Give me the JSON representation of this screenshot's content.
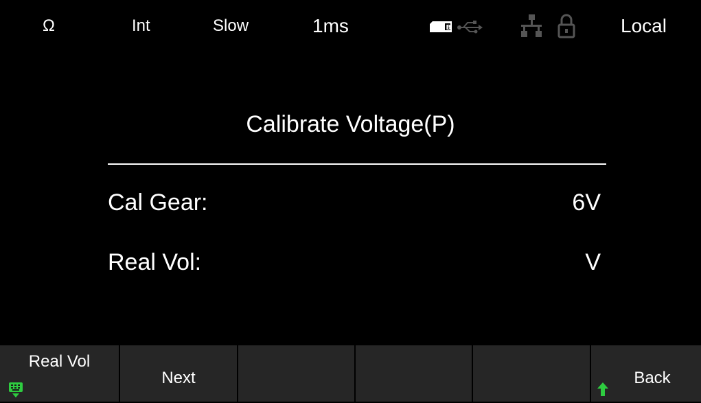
{
  "status": {
    "mode_symbol": "Ω",
    "trigger": "Int",
    "speed": "Slow",
    "time": "1ms",
    "remote_state": "Local",
    "icons": [
      "memory-card-icon",
      "usb-icon",
      "network-icon",
      "lock-icon"
    ]
  },
  "main": {
    "title": "Calibrate Voltage(P)",
    "rows": [
      {
        "label": "Cal Gear:",
        "value": "6V"
      },
      {
        "label": "Real Vol:",
        "value": "V"
      }
    ]
  },
  "softkeys": [
    {
      "label": "Real Vol",
      "icon": "keypad-icon"
    },
    {
      "label": "Next"
    },
    {
      "label": ""
    },
    {
      "label": ""
    },
    {
      "label": ""
    },
    {
      "label": "Back",
      "icon": "arrow-up-icon"
    }
  ],
  "colors": {
    "background": "#000000",
    "softkey_bg": "#262626",
    "accent_green": "#2ecc40"
  }
}
